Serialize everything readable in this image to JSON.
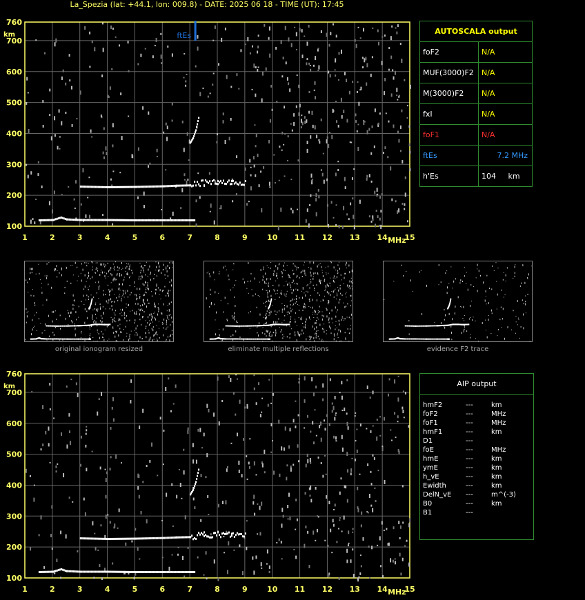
{
  "header": {
    "title": "La_Spezia (lat: +44.1, lon: 009.8) - DATE: 2025 06 18 - TIME (UT): 17:45"
  },
  "autoscala": {
    "heading": "AUTOSCALA output",
    "rows": [
      {
        "param": "foF2",
        "value": "N/A",
        "color": "#ffffff",
        "value_color": "#ffff00"
      },
      {
        "param": "MUF(3000)F2",
        "value": "N/A",
        "color": "#ffffff",
        "value_color": "#ffff00"
      },
      {
        "param": "M(3000)F2",
        "value": "N/A",
        "color": "#ffffff",
        "value_color": "#ffff00"
      },
      {
        "param": "fxI",
        "value": "N/A",
        "color": "#ffffff",
        "value_color": "#ffff00"
      },
      {
        "param": "foF1",
        "value": "N/A",
        "color": "#ff3030",
        "value_color": "#ff3030"
      },
      {
        "param": "ftEs",
        "value": "7.2 MHz",
        "color": "#3399ff",
        "value_color": "#3399ff"
      }
    ],
    "hEs": {
      "param": "h'Es",
      "value": "104",
      "unit": "km"
    }
  },
  "aip": {
    "heading": "AIP output",
    "rows": [
      {
        "param": "hmF2",
        "value": "---",
        "unit": "km"
      },
      {
        "param": "foF2",
        "value": "---",
        "unit": "MHz"
      },
      {
        "param": "foF1",
        "value": "---",
        "unit": "MHz"
      },
      {
        "param": "hmF1",
        "value": "---",
        "unit": "km"
      },
      {
        "param": "D1",
        "value": "---",
        "unit": ""
      },
      {
        "param": "foE",
        "value": "---",
        "unit": "MHz"
      },
      {
        "param": "hmE",
        "value": "---",
        "unit": "km"
      },
      {
        "param": "ymE",
        "value": "---",
        "unit": "km"
      },
      {
        "param": "h_vE",
        "value": "---",
        "unit": "km"
      },
      {
        "param": "Ewidth",
        "value": "---",
        "unit": "km"
      },
      {
        "param": "DelN_vE",
        "value": "---",
        "unit": "m^(-3)"
      },
      {
        "param": "B0",
        "value": "---",
        "unit": "km"
      },
      {
        "param": "B1",
        "value": "---",
        "unit": ""
      }
    ]
  },
  "captions": [
    "original ionogram resized",
    "eliminate multiple reflections",
    "evidence F2 trace"
  ],
  "chart_data": [
    {
      "type": "scatter",
      "x_ticks": [
        1,
        2,
        3,
        4,
        5,
        6,
        7,
        8,
        9,
        10,
        11,
        12,
        13,
        14,
        15
      ],
      "y_ticks": [
        100,
        200,
        300,
        400,
        500,
        600,
        700,
        760
      ],
      "xlim": [
        1,
        15
      ],
      "ylim": [
        100,
        760
      ],
      "x_unit": "MHz",
      "y_unit": "km",
      "grid": true,
      "traces": [
        {
          "name": "Es",
          "points": [
            [
              1.5,
              119
            ],
            [
              2,
              120
            ],
            [
              2.3,
              128
            ],
            [
              2.5,
              122
            ],
            [
              3,
              120
            ],
            [
              4,
              120
            ],
            [
              5,
              119
            ],
            [
              6,
              119
            ],
            [
              7,
              119
            ],
            [
              7.15,
              119
            ]
          ]
        },
        {
          "name": "F",
          "points": [
            [
              3,
              228
            ],
            [
              4,
              226
            ],
            [
              5,
              227
            ],
            [
              6,
              229
            ],
            [
              6.5,
              231
            ],
            [
              7,
              232
            ],
            [
              7.5,
              240
            ],
            [
              8,
              240
            ],
            [
              8.5,
              238
            ],
            [
              9,
              240
            ]
          ]
        },
        {
          "name": "F-upper",
          "points": [
            [
              7.0,
              370
            ],
            [
              7.1,
              385
            ],
            [
              7.2,
              410
            ],
            [
              7.3,
              450
            ]
          ]
        }
      ],
      "ftEs_marker": {
        "label": "ftEs",
        "x": 7.2
      },
      "color_marker": "#1e6fd9"
    }
  ]
}
